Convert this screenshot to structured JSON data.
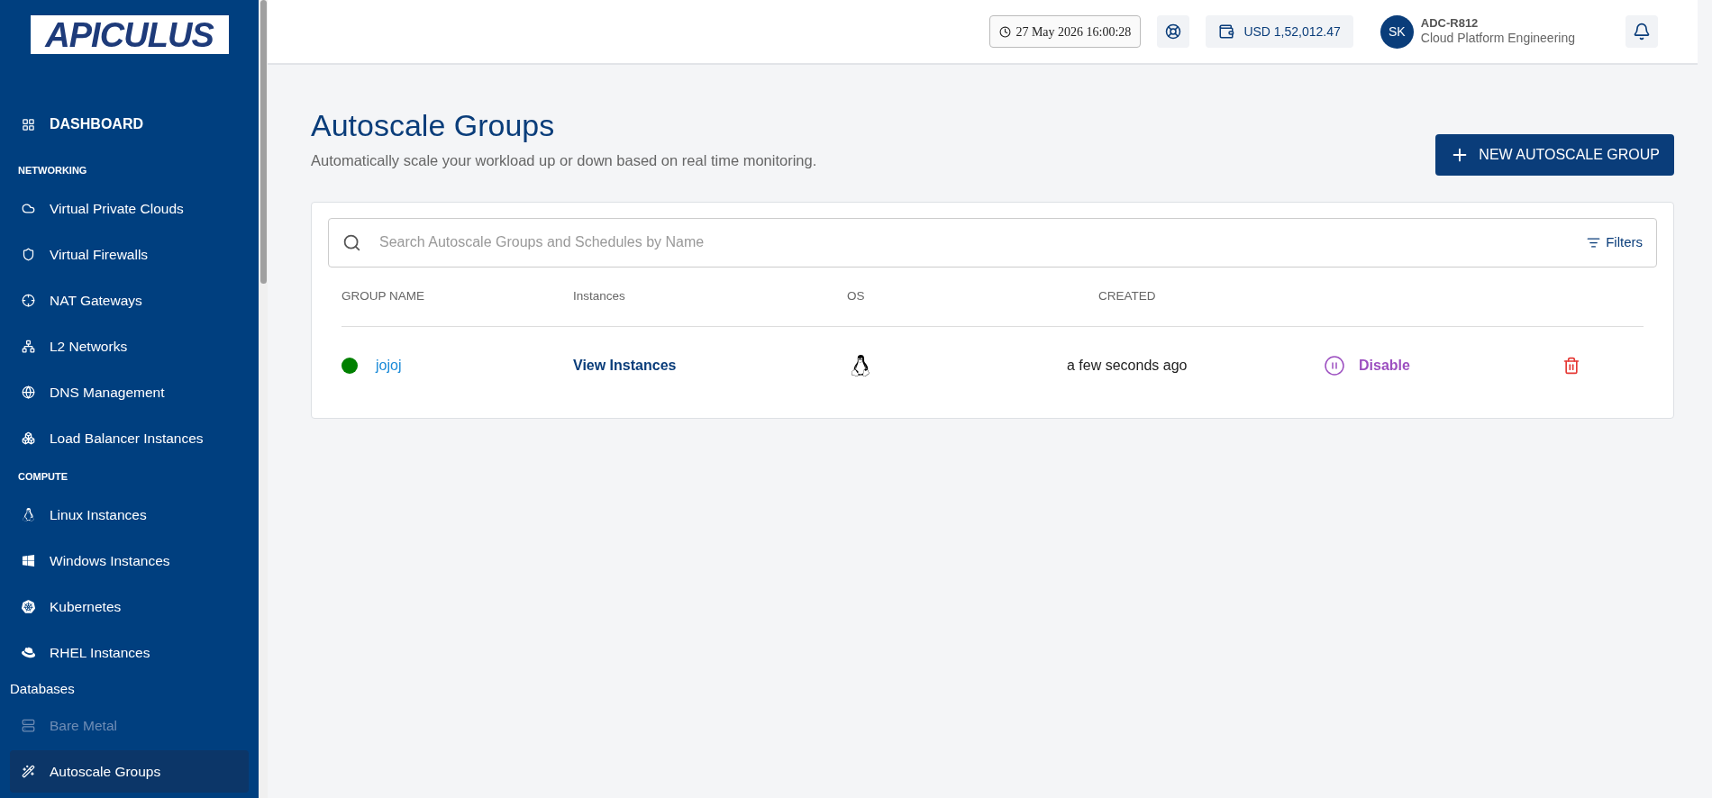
{
  "logo": {
    "text": "APICULUS"
  },
  "sidebar": {
    "items": [
      {
        "kind": "top",
        "label": "DASHBOARD",
        "selected": false,
        "disabled": false
      },
      {
        "kind": "section",
        "label": "NETWORKING"
      },
      {
        "kind": "item",
        "label": "Virtual Private Clouds",
        "selected": false,
        "disabled": false
      },
      {
        "kind": "item",
        "label": "Virtual Firewalls",
        "selected": false,
        "disabled": false
      },
      {
        "kind": "item",
        "label": "NAT Gateways",
        "selected": false,
        "disabled": false
      },
      {
        "kind": "item",
        "label": "L2 Networks",
        "selected": false,
        "disabled": false
      },
      {
        "kind": "item",
        "label": "DNS Management",
        "selected": false,
        "disabled": false
      },
      {
        "kind": "item",
        "label": "Load Balancer Instances",
        "selected": false,
        "disabled": false
      },
      {
        "kind": "section",
        "label": "COMPUTE"
      },
      {
        "kind": "item",
        "label": "Linux Instances",
        "selected": false,
        "disabled": false
      },
      {
        "kind": "item",
        "label": "Windows Instances",
        "selected": false,
        "disabled": false
      },
      {
        "kind": "item",
        "label": "Kubernetes",
        "selected": false,
        "disabled": false
      },
      {
        "kind": "item",
        "label": "RHEL Instances",
        "selected": false,
        "disabled": false
      },
      {
        "kind": "group",
        "label": "Databases"
      },
      {
        "kind": "item",
        "label": "Bare Metal",
        "selected": false,
        "disabled": true
      },
      {
        "kind": "item",
        "label": "Autoscale Groups",
        "selected": true,
        "disabled": false
      }
    ]
  },
  "header": {
    "datetime": "27 May 2026 16:00:28",
    "balance": "USD 1,52,012.47",
    "user": {
      "initials": "SK",
      "name": "ADC-R812",
      "org": "Cloud Platform Engineering"
    }
  },
  "page": {
    "title": "Autoscale Groups",
    "subtitle": "Automatically scale your workload up or down based on real time monitoring.",
    "new_button": "NEW AUTOSCALE GROUP"
  },
  "search": {
    "placeholder": "Search Autoscale Groups and Schedules by Name",
    "filters": "Filters"
  },
  "table": {
    "columns": [
      "GROUP NAME",
      "Instances",
      "OS",
      "CREATED"
    ],
    "rows": [
      {
        "color": "#008000",
        "name": "jojoj",
        "instances_link": "View Instances",
        "created": "a few seconds ago",
        "action": "Disable"
      }
    ]
  }
}
